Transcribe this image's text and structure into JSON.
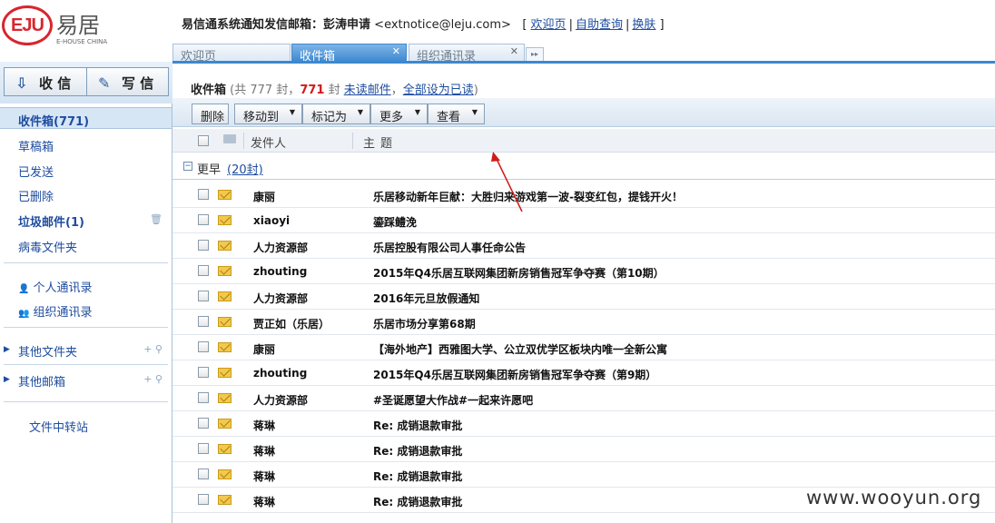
{
  "header": {
    "brand_logo_text": "EJU",
    "brand_cn": "易居",
    "brand_en": "E-HOUSE CHINA",
    "sender_label": "易信通系统通知发信邮箱：",
    "user_name": "彭涛申请",
    "email": "<extnotice@leju.com>",
    "links": {
      "home": "欢迎页",
      "self_query": "自助查询",
      "skin": "换肤"
    }
  },
  "tabs": [
    {
      "label": "欢迎页"
    },
    {
      "label": "收件箱"
    },
    {
      "label": "组织通讯录"
    }
  ],
  "sidebar": {
    "receive_label": "收 信",
    "compose_label": "写 信",
    "inbox_label": "收件箱(771)",
    "items": [
      {
        "label": "草稿箱"
      },
      {
        "label": "已发送"
      },
      {
        "label": "已删除"
      },
      {
        "label": "垃圾邮件(1)"
      },
      {
        "label": "病毒文件夹"
      }
    ],
    "contacts": [
      {
        "label": "个人通讯录"
      },
      {
        "label": "组织通讯录"
      }
    ],
    "other_folders": "其他文件夹",
    "other_mailboxes": "其他邮箱",
    "file_transfer": "文件中转站"
  },
  "main": {
    "title": "收件箱",
    "total_prefix": "(共 777 封，",
    "unread_count": "771",
    "unread_suffix": " 封 ",
    "unread_link": "未读邮件",
    "comma": "，",
    "mark_all_read": "全部设为已读",
    "close_paren": ")"
  },
  "toolbar": {
    "delete": "删除",
    "move_to": "移动到",
    "mark_as": "标记为",
    "more": "更多",
    "view": "查看"
  },
  "columns": {
    "sender": "发件人",
    "subject": "主题"
  },
  "group": {
    "label": "更早",
    "count": "(20封)"
  },
  "emails": [
    {
      "sender": "康丽",
      "subject": "乐居移动新年巨献：大胜归来游戏第一波-裂变红包，提钱开火！"
    },
    {
      "sender": "xiaoyi",
      "subject": "鎏踩鳢浼"
    },
    {
      "sender": "人力资源部",
      "subject": "乐居控股有限公司人事任命公告"
    },
    {
      "sender": "zhouting",
      "subject": "2015年Q4乐居互联网集团新房销售冠军争夺赛（第10期）"
    },
    {
      "sender": "人力资源部",
      "subject": "2016年元旦放假通知"
    },
    {
      "sender": "贾正如（乐居）",
      "subject": "乐居市场分享第68期"
    },
    {
      "sender": "康丽",
      "subject": "【海外地产】西雅图大学、公立双优学区板块内唯一全新公寓"
    },
    {
      "sender": "zhouting",
      "subject": "2015年Q4乐居互联网集团新房销售冠军争夺赛（第9期）"
    },
    {
      "sender": "人力资源部",
      "subject": "#圣诞愿望大作战#一起来许愿吧"
    },
    {
      "sender": "蒋琳",
      "subject": "Re: 成销退款审批"
    },
    {
      "sender": "蒋琳",
      "subject": "Re: 成销退款审批"
    },
    {
      "sender": "蒋琳",
      "subject": "Re: 成销退款审批"
    },
    {
      "sender": "蒋琳",
      "subject": "Re: 成销退款审批"
    }
  ],
  "watermark": "www.wooyun.org",
  "colors": {
    "accent": "#3d88cf",
    "link": "#1f4da0",
    "unread_red": "#d01a1a",
    "brand_red": "#d8262e"
  }
}
